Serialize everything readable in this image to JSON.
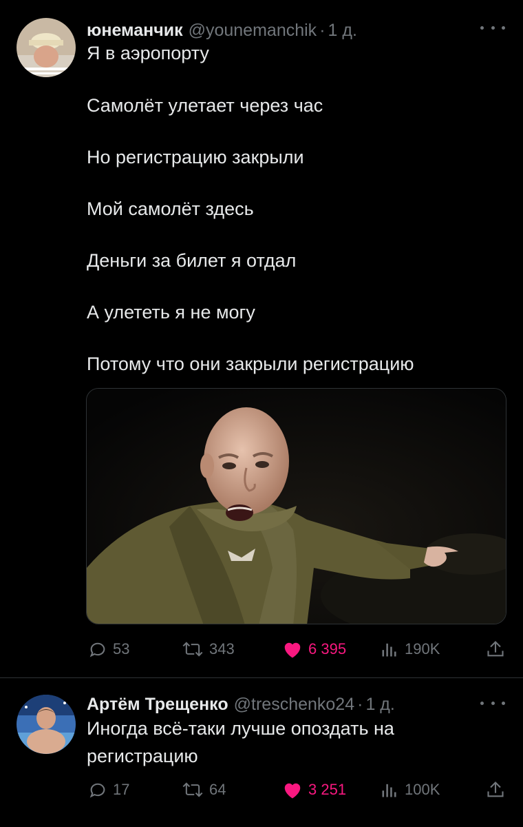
{
  "tweets": [
    {
      "author": "юнеманчик",
      "handle": "@younemanchik",
      "time": "1 д.",
      "lines": [
        "Я в аэропорту",
        "Самолёт улетает через час",
        "Но регистрацию закрыли",
        "Мой самолёт здесь",
        "Деньги за билет я отдал",
        "А улететь я не могу",
        "Потому что они закрыли регистрацию"
      ],
      "stats": {
        "replies": "53",
        "retweets": "343",
        "likes": "6 395",
        "views": "190K"
      }
    },
    {
      "author": "Артём Трещенко",
      "handle": "@treschenko24",
      "time": "1 д.",
      "lines": [
        "Иногда всё-таки лучше опоздать на",
        "регистрацию"
      ],
      "stats": {
        "replies": "17",
        "retweets": "64",
        "likes": "3 251",
        "views": "100K"
      }
    }
  ],
  "icons": {
    "reply": "reply-icon",
    "retweet": "retweet-icon",
    "like": "heart-icon",
    "views": "views-icon",
    "share": "share-icon",
    "more": "more-icon"
  },
  "colors": {
    "background": "#000000",
    "text": "#e7e9ea",
    "muted": "#71767b",
    "like": "#f91880",
    "divider": "#2f3336"
  }
}
